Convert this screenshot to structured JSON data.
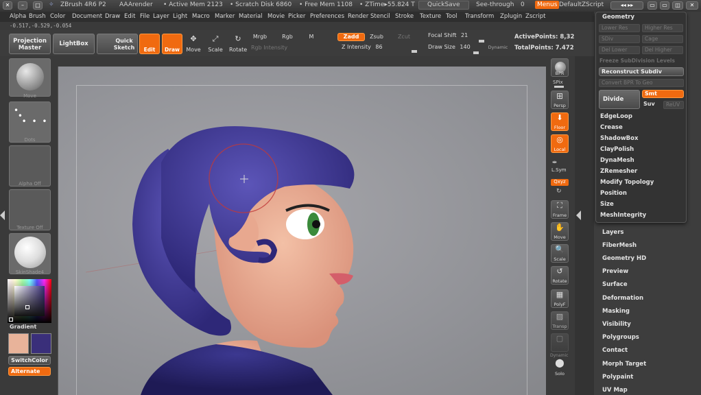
{
  "titlebar": {
    "app": "ZBrush 4R6 P2",
    "doc": "AAArender",
    "active_mem": "• Active Mem 2123",
    "scratch_disk": "• Scratch Disk 6860",
    "free_mem": "• Free Mem 1108",
    "ztime": "• ZTime▸55.824 T",
    "quicksave": "QuickSave",
    "see_through": "See-through",
    "see_through_value": "0",
    "menus": "Menus",
    "zscript": "DefaultZScript"
  },
  "menubar": [
    "Alpha",
    "Brush",
    "Color",
    "Document",
    "Draw",
    "Edit",
    "File",
    "Layer",
    "Light",
    "Macro",
    "Marker",
    "Material",
    "Movie",
    "Picker",
    "Preferences",
    "Render",
    "Stencil",
    "Stroke",
    "Texture",
    "Tool",
    "Transform",
    "Zplugin",
    "Zscript"
  ],
  "coords": "-0.517,-0.529,-0.054",
  "toolbar": {
    "projection_master": "Projection Master",
    "lightbox": "LightBox",
    "quick_sketch": "Quick Sketch",
    "edit": "Edit",
    "draw": "Draw",
    "move": "Move",
    "scale": "Scale",
    "rotate": "Rotate",
    "mrgb": "Mrgb",
    "rgb": "Rgb",
    "m": "M",
    "rgb_intensity": "Rgb Intensity",
    "zadd": "Zadd",
    "zsub": "Zsub",
    "zcut": "Zcut",
    "z_intensity": "Z Intensity",
    "z_intensity_value": "86",
    "focal_shift": "Focal Shift",
    "focal_shift_value": "21",
    "draw_size": "Draw Size",
    "draw_size_value": "140",
    "dynamic": "Dynamic",
    "active_points": "ActivePoints: 8,32",
    "total_points": "TotalPoints: 7.472"
  },
  "left": {
    "move": "Move",
    "dots": "Dots",
    "alpha_off": "Alpha Off",
    "texture_off": "Texture Off",
    "material": "SkinShade4",
    "gradient": "Gradient",
    "switch_color": "SwitchColor",
    "alternate": "Alternate",
    "main_color": "#e8b39a",
    "secondary_color": "#3a2f7a"
  },
  "shelf": {
    "bpr": "BPR",
    "spix": "SPix",
    "persp": "Persp",
    "floor": "Floor",
    "local": "Local",
    "lsym": "L.Sym",
    "xyz": "Qxyz",
    "frame": "Frame",
    "move": "Move",
    "scale": "Scale",
    "rotate": "Rotate",
    "polyf": "PolyF",
    "transp": "Transp",
    "dynamic": "Dynamic",
    "solo": "Solo"
  },
  "geometry": {
    "title": "Geometry",
    "lower_res": "Lower Res",
    "higher_res": "Higher Res",
    "sdiv": "SDiv",
    "del_lower": "Del Lower",
    "del_higher": "Del Higher",
    "cage": "Cage",
    "freeze": "Freeze SubDivision Levels",
    "reconstruct": "Reconstruct Subdiv",
    "convert_bpr": "Convert BPR To Geo",
    "divide": "Divide",
    "smt": "Smt",
    "suv": "Suv",
    "reuv": "ReUV",
    "items": [
      "EdgeLoop",
      "Crease",
      "ShadowBox",
      "ClayPolish",
      "DynaMesh",
      "ZRemesher",
      "Modify Topology",
      "Position",
      "Size",
      "MeshIntegrity"
    ]
  },
  "subpalettes": [
    "Layers",
    "FiberMesh",
    "Geometry HD",
    "Preview",
    "Surface",
    "Deformation",
    "Masking",
    "Visibility",
    "Polygroups",
    "Contact",
    "Morph Target",
    "Polypaint",
    "UV Map"
  ]
}
